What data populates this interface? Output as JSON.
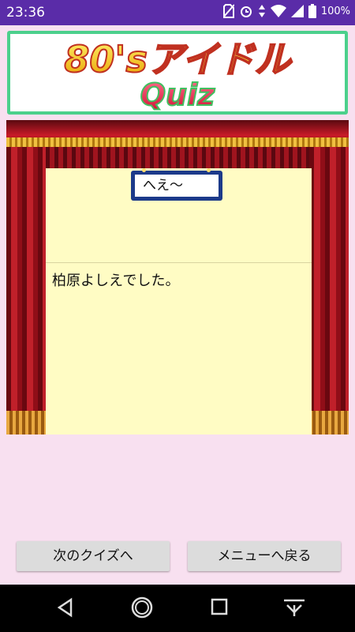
{
  "status_bar": {
    "time": "23:36",
    "battery": "100%",
    "icons": [
      "no-sim-icon",
      "alarm-icon",
      "data-arrows-icon",
      "wifi-icon",
      "signal-icon",
      "battery-icon"
    ]
  },
  "banner": {
    "line1": "80'sアイドル",
    "line2": "Quiz",
    "colors": {
      "gold": "#f2c200",
      "red": "#e83040",
      "border": "#4cd08c"
    }
  },
  "stage": {
    "sign_text": "へえ～",
    "answer": "柏原よしえでした。"
  },
  "buttons": {
    "next": "次のクイズへ",
    "menu": "メニューへ戻る"
  },
  "nav": [
    "back-icon",
    "home-icon",
    "recents-icon",
    "keyboard-hide-icon"
  ]
}
